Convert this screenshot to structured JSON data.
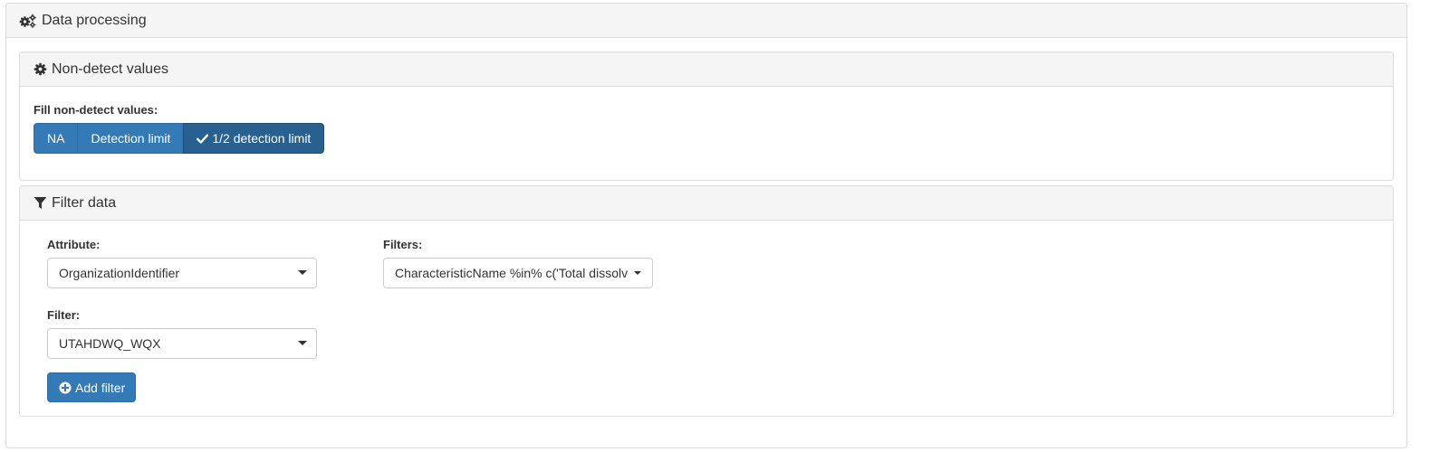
{
  "data_processing": {
    "title": "Data processing",
    "icon": "cogs-icon"
  },
  "non_detect": {
    "title": "Non-detect values",
    "icon": "cog-icon",
    "fill_label": "Fill non-detect values:",
    "options": [
      {
        "label": "NA",
        "selected": false
      },
      {
        "label": "Detection limit",
        "selected": false
      },
      {
        "label": "1/2 detection limit",
        "selected": true
      }
    ]
  },
  "filter_data": {
    "title": "Filter data",
    "icon": "filter-icon",
    "attribute_label": "Attribute:",
    "attribute_value": "OrganizationIdentifier",
    "filter_label": "Filter:",
    "filter_value": "UTAHDWQ_WQX",
    "filters_label": "Filters:",
    "filters_value": "CharacteristicName %in% c('Total dissolved",
    "add_filter_label": "Add filter"
  },
  "colors": {
    "primary": "#337ab7",
    "primary_active": "#286090",
    "panel_heading_bg": "#f5f5f5",
    "border": "#dddddd"
  }
}
